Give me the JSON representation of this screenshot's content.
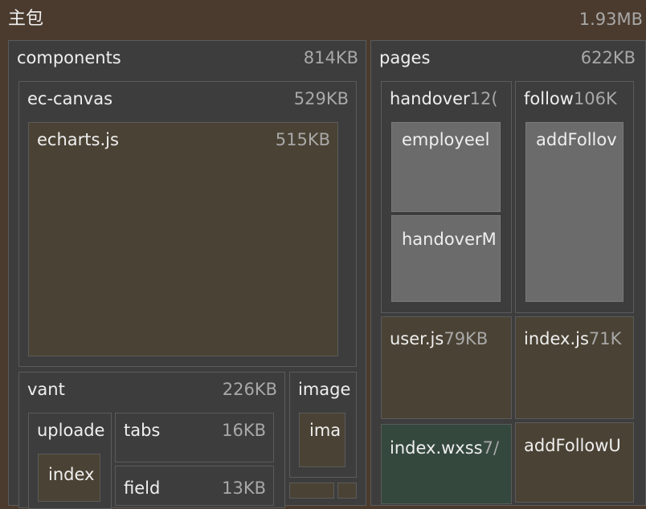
{
  "root": {
    "label": "主包",
    "size": "1.93MB"
  },
  "components": {
    "label": "components",
    "size": "814KB",
    "ec_canvas": {
      "label": "ec-canvas",
      "size": "529KB",
      "echarts": {
        "label": "echarts.js",
        "size": "515KB"
      }
    },
    "vant": {
      "label": "vant",
      "size": "226KB",
      "uploader": {
        "label": "uploade",
        "child": "index"
      },
      "tabs": {
        "label": "tabs",
        "size": "16KB"
      },
      "field": {
        "label": "field",
        "size": "13KB"
      }
    },
    "image": {
      "label": "image",
      "child": "ima"
    }
  },
  "pages": {
    "label": "pages",
    "size": "622KB",
    "handover": {
      "label": "handover",
      "size": "12(",
      "employee": {
        "label": "employeel"
      },
      "handoverM": {
        "label": "handoverM"
      }
    },
    "follow": {
      "label": "follow",
      "size": "106K",
      "addFollow": {
        "label": "addFollov"
      }
    },
    "user_js": {
      "label": "user.js",
      "size": "79KB"
    },
    "index_js": {
      "label": "index.js",
      "size": "71K"
    },
    "index_wxss": {
      "label": "index.wxss",
      "size": "7/"
    },
    "addFollowU": {
      "label": "addFollowU"
    }
  }
}
